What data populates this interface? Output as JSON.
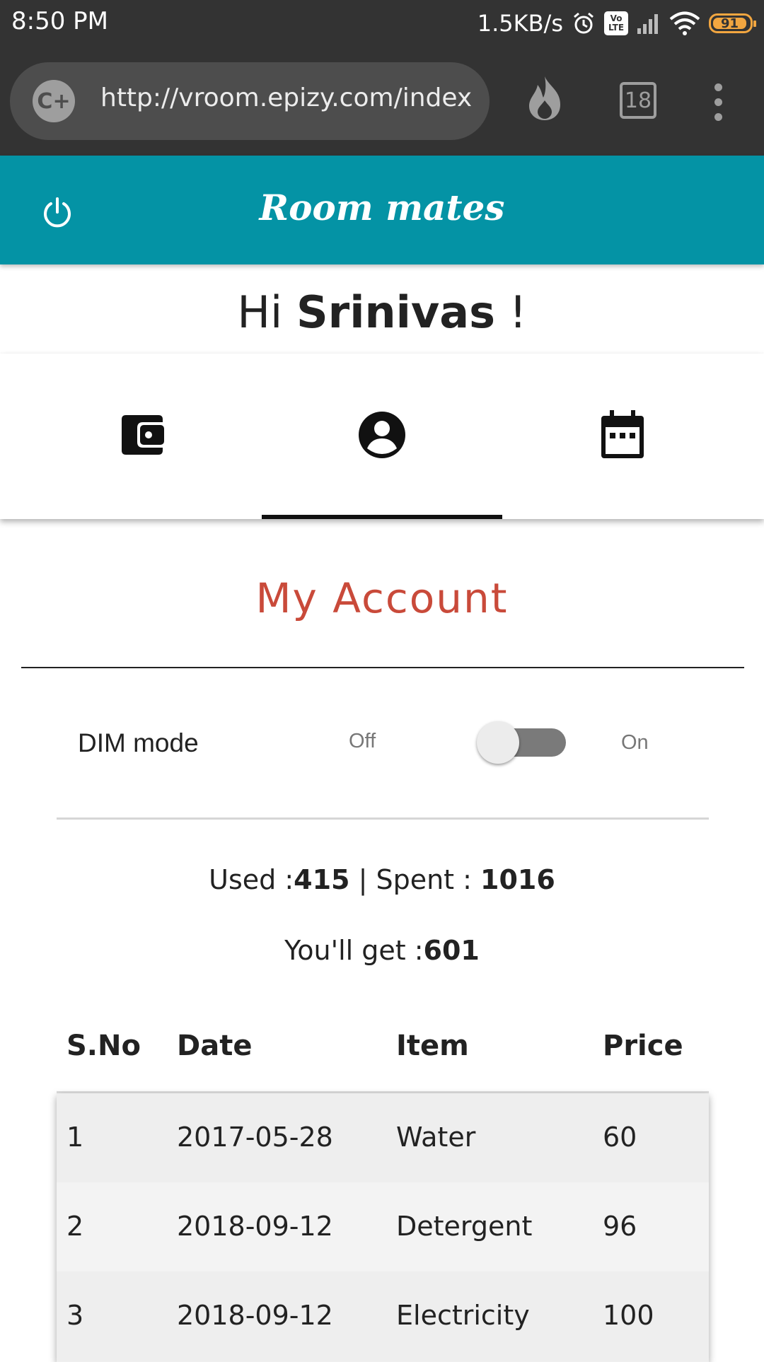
{
  "status_bar": {
    "time": "8:50 PM",
    "network_speed": "1.5KB/s",
    "volte_label": "Vo LTE",
    "battery": "91",
    "icons": [
      "alarm-icon",
      "volte-icon",
      "signal-icon",
      "wifi-icon",
      "battery-icon"
    ]
  },
  "browser": {
    "url": "http://vroom.epizy.com/index.php",
    "site_icon": "C+",
    "tab_count": "18"
  },
  "app": {
    "title": "Room mates",
    "header_color": "#0493a5"
  },
  "greeting": {
    "prefix": "Hi ",
    "name": "Srinivas",
    "suffix": " !"
  },
  "tabs": [
    {
      "icon": "wallet-icon",
      "active": false
    },
    {
      "icon": "account-circle-icon",
      "active": true
    },
    {
      "icon": "calendar-icon",
      "active": false
    }
  ],
  "account": {
    "title": "My Account",
    "title_color": "#c94a3a",
    "dim_mode_label": "DIM mode",
    "off_label": "Off",
    "on_label": "On",
    "used_label": "Used :",
    "used_value": "415",
    "separator": " | ",
    "spent_label": "Spent : ",
    "spent_value": "1016",
    "get_label": "You'll get :",
    "get_value": "601"
  },
  "table": {
    "headers": [
      "S.No",
      "Date",
      "Item",
      "Price"
    ],
    "rows": [
      [
        "1",
        "2017-05-28",
        "Water",
        "60"
      ],
      [
        "2",
        "2018-09-12",
        "Detergent",
        "96"
      ],
      [
        "3",
        "2018-09-12",
        "Electricity",
        "100"
      ]
    ]
  }
}
